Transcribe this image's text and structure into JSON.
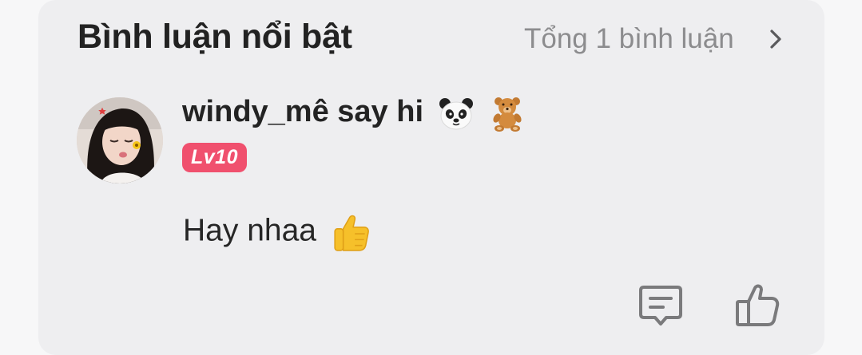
{
  "header": {
    "title": "Bình luận nổi bật",
    "total_label": "Tổng 1 bình luận"
  },
  "comment": {
    "username": "windy_mê say hi",
    "username_emojis": [
      "panda-emoji",
      "teddy-bear-emoji"
    ],
    "level_badge": "Lv10",
    "text": "Hay nhaa",
    "text_emoji": "thumbs-up-emoji"
  },
  "actions": {
    "reply_icon": "comment-reply-icon",
    "like_icon": "thumbs-up-outline-icon"
  },
  "colors": {
    "card_background": "#eeeef0",
    "level_badge": "#f0506e",
    "muted_text": "#8c8c8e"
  }
}
